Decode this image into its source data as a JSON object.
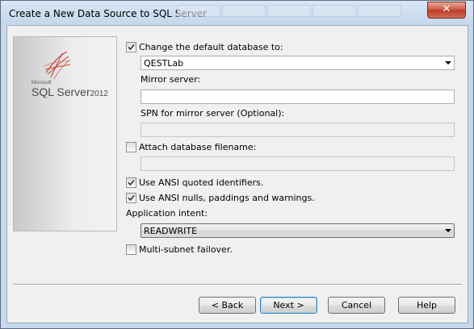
{
  "window": {
    "title": "Create a New Data Source to SQL Server",
    "close_glyph": "✕"
  },
  "logo": {
    "microsoft": "Microsoft",
    "product": "SQL Server",
    "year": "2012",
    "icon": "sql-server-logo-icon"
  },
  "form": {
    "change_db": {
      "label": "Change the default database to:",
      "checked": true,
      "value": "QESTLab"
    },
    "mirror_server": {
      "label": "Mirror server:",
      "value": ""
    },
    "spn": {
      "label": "SPN for mirror server (Optional):",
      "value": ""
    },
    "attach_db": {
      "label": "Attach database filename:",
      "checked": false,
      "value": ""
    },
    "ansi_quoted": {
      "label": "Use ANSI quoted identifiers.",
      "checked": true
    },
    "ansi_nulls": {
      "label": "Use ANSI nulls, paddings and warnings.",
      "checked": true
    },
    "app_intent": {
      "label": "Application intent:",
      "value": "READWRITE"
    },
    "multisubnet": {
      "label": "Multi-subnet failover.",
      "checked": false
    }
  },
  "buttons": {
    "back": "< Back",
    "next": "Next >",
    "cancel": "Cancel",
    "help": "Help"
  },
  "colors": {
    "titlebar": "#c5d7eb",
    "client": "#f0f0f0",
    "close": "#c9523e",
    "default_button_border": "#3c7fb1"
  }
}
